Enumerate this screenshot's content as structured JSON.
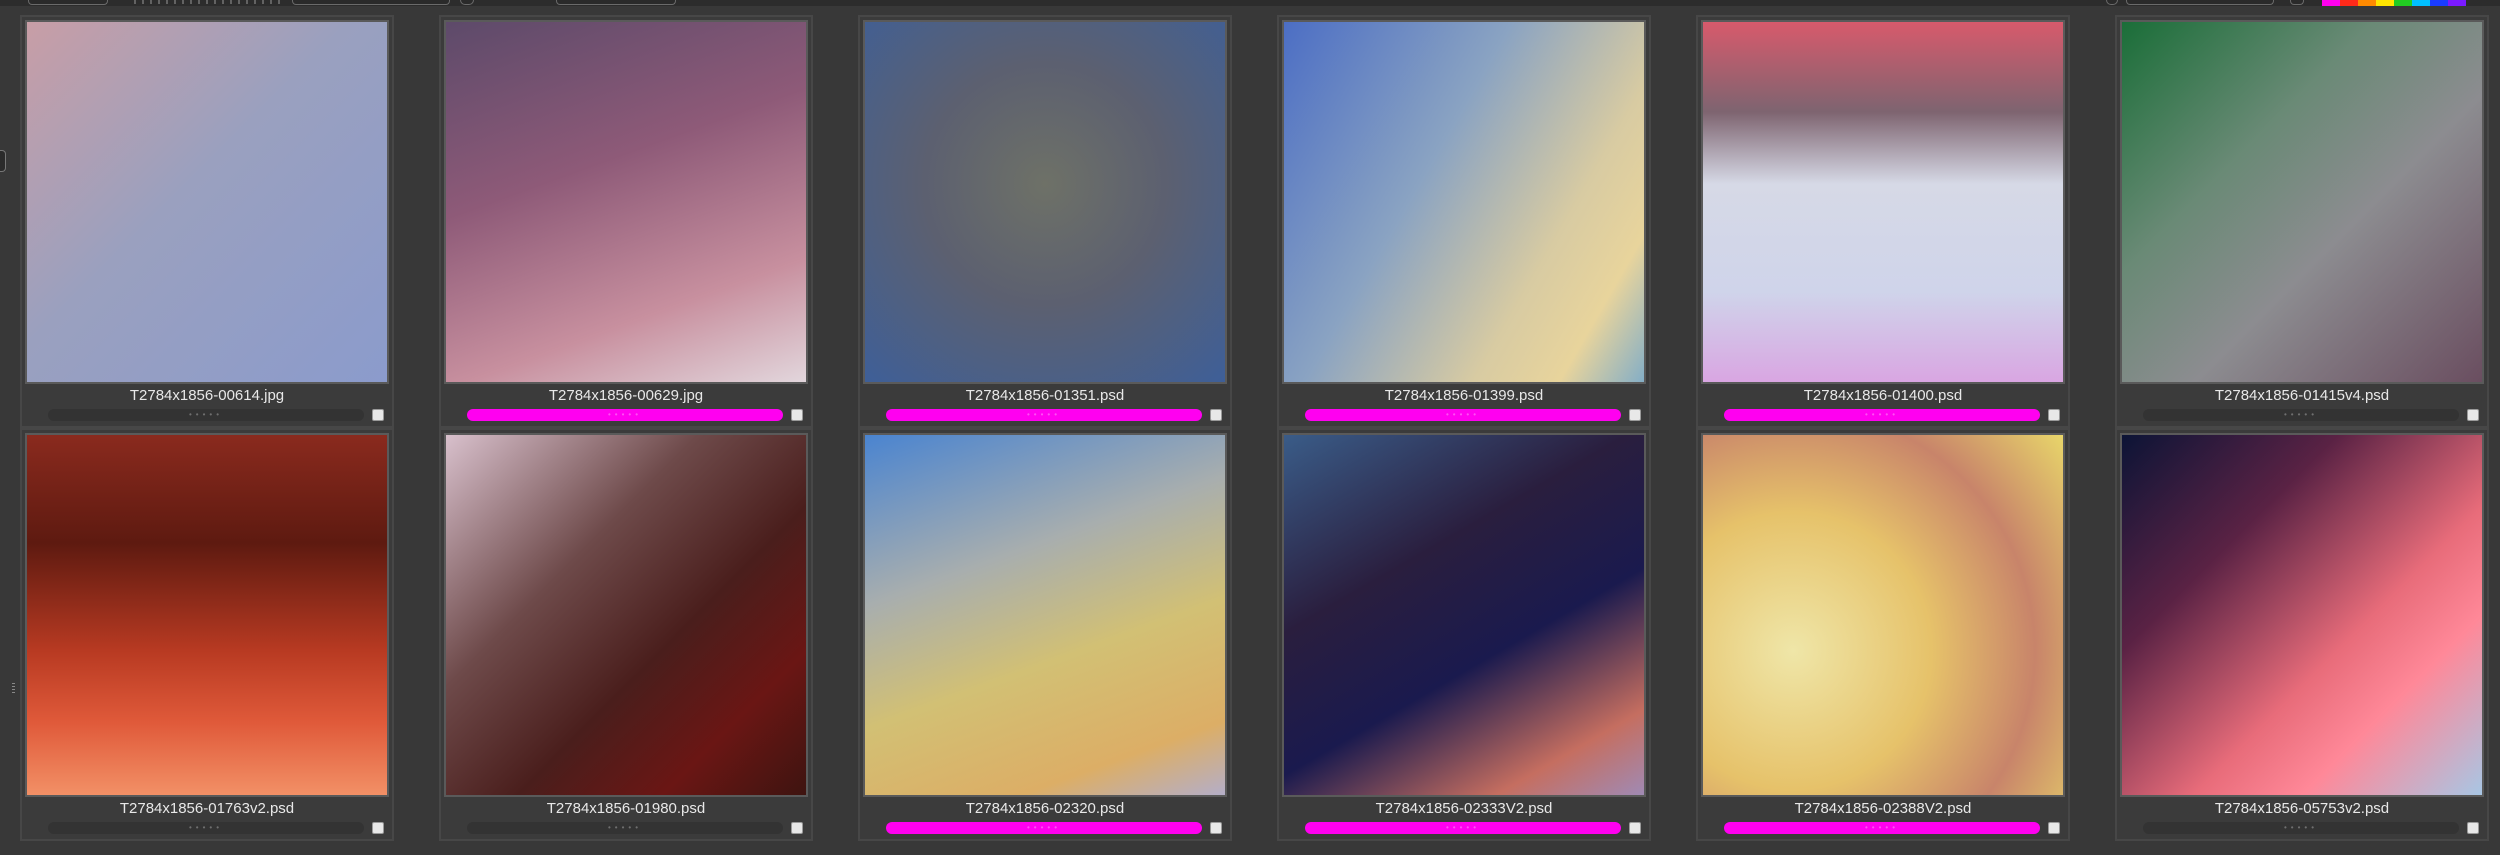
{
  "browser": {
    "label_colors": [
      "#ff00ee",
      "#ff2a1a",
      "#ff8a00",
      "#ffe600",
      "#22cc22",
      "#00bfff",
      "#1a3cff",
      "#7a1aff"
    ],
    "items": [
      {
        "filename": "T2784x1856-00614.jpg",
        "label": "none",
        "checked": true
      },
      {
        "filename": "T2784x1856-00629.jpg",
        "label": "magenta",
        "checked": true
      },
      {
        "filename": "T2784x1856-01351.psd",
        "label": "magenta",
        "checked": true
      },
      {
        "filename": "T2784x1856-01399.psd",
        "label": "magenta",
        "checked": true
      },
      {
        "filename": "T2784x1856-01400.psd",
        "label": "magenta",
        "checked": true
      },
      {
        "filename": "T2784x1856-01415v4.psd",
        "label": "none",
        "checked": true
      },
      {
        "filename": "T2784x1856-01763v2.psd",
        "label": "none",
        "checked": true
      },
      {
        "filename": "T2784x1856-01980.psd",
        "label": "none",
        "checked": true
      },
      {
        "filename": "T2784x1856-02320.psd",
        "label": "magenta",
        "checked": true
      },
      {
        "filename": "T2784x1856-02333V2.psd",
        "label": "magenta",
        "checked": true
      },
      {
        "filename": "T2784x1856-02388V2.psd",
        "label": "magenta",
        "checked": true
      },
      {
        "filename": "T2784x1856-05753v2.psd",
        "label": "none",
        "checked": true
      }
    ]
  }
}
